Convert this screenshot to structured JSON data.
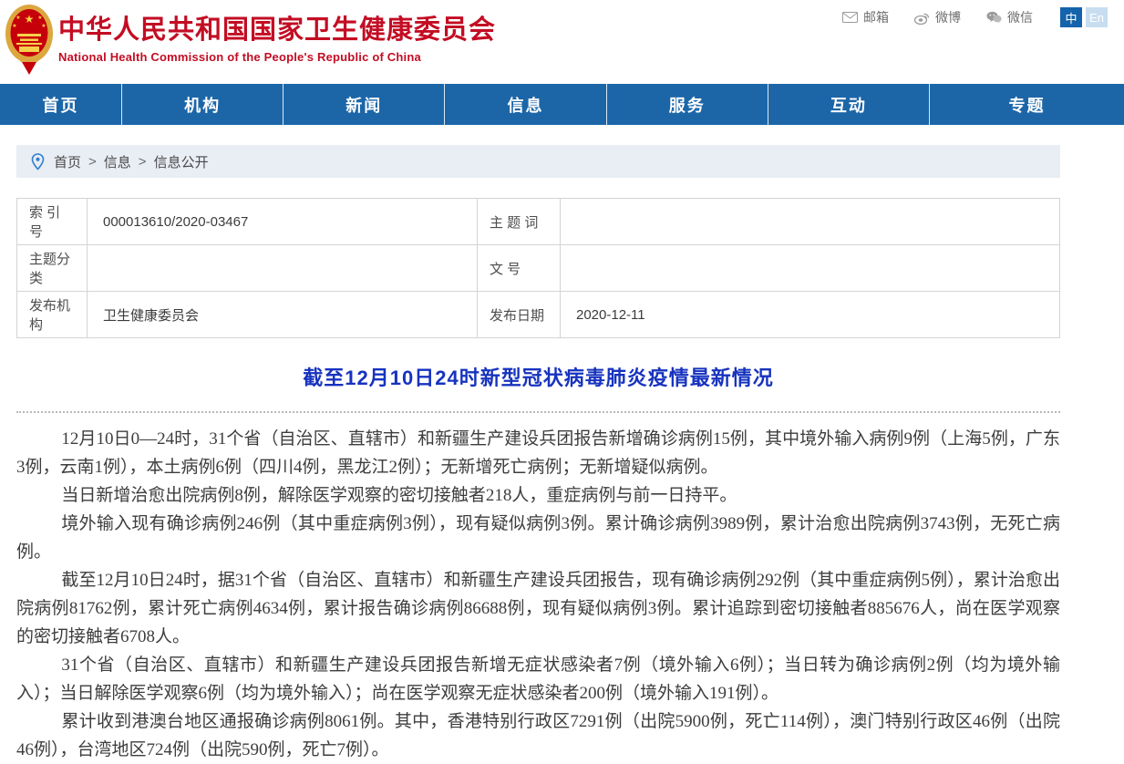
{
  "header": {
    "site_title": "中华人民共和国国家卫生健康委员会",
    "site_subtitle": "National Health Commission of the People's Republic of China",
    "social": [
      {
        "icon": "mail-icon",
        "label": "邮箱"
      },
      {
        "icon": "weibo-icon",
        "label": "微博"
      },
      {
        "icon": "wechat-icon",
        "label": "微信"
      }
    ],
    "lang": {
      "zh": "中",
      "en": "En"
    }
  },
  "nav": {
    "items": [
      {
        "label": "首页"
      },
      {
        "label": "机构"
      },
      {
        "label": "新闻"
      },
      {
        "label": "信息"
      },
      {
        "label": "服务"
      },
      {
        "label": "互动"
      },
      {
        "label": "专题"
      }
    ]
  },
  "breadcrumb": {
    "separator": ">",
    "items": [
      "首页",
      "信息",
      "信息公开"
    ]
  },
  "info_table": {
    "rows": [
      {
        "label1": "索 引 号",
        "value1": "000013610/2020-03467",
        "label2": "主 题 词",
        "value2": ""
      },
      {
        "label1": "主题分类",
        "value1": "",
        "label2": "文  号",
        "value2": ""
      },
      {
        "label1": "发布机构",
        "value1": "卫生健康委员会",
        "label2": "发布日期",
        "value2": "2020-12-11"
      }
    ]
  },
  "article": {
    "title": "截至12月10日24时新型冠状病毒肺炎疫情最新情况",
    "paragraphs": [
      "12月10日0—24时，31个省（自治区、直辖市）和新疆生产建设兵团报告新增确诊病例15例，其中境外输入病例9例（上海5例，广东3例，云南1例），本土病例6例（四川4例，黑龙江2例）；无新增死亡病例；无新增疑似病例。",
      "当日新增治愈出院病例8例，解除医学观察的密切接触者218人，重症病例与前一日持平。",
      "境外输入现有确诊病例246例（其中重症病例3例），现有疑似病例3例。累计确诊病例3989例，累计治愈出院病例3743例，无死亡病例。",
      "截至12月10日24时，据31个省（自治区、直辖市）和新疆生产建设兵团报告，现有确诊病例292例（其中重症病例5例），累计治愈出院病例81762例，累计死亡病例4634例，累计报告确诊病例86688例，现有疑似病例3例。累计追踪到密切接触者885676人，尚在医学观察的密切接触者6708人。",
      "31个省（自治区、直辖市）和新疆生产建设兵团报告新增无症状感染者7例（境外输入6例）；当日转为确诊病例2例（均为境外输入）；当日解除医学观察6例（均为境外输入）；尚在医学观察无症状感染者200例（境外输入191例）。",
      "累计收到港澳台地区通报确诊病例8061例。其中，香港特别行政区7291例（出院5900例，死亡114例），澳门特别行政区46例（出院46例），台湾地区724例（出院590例，死亡7例）。"
    ]
  },
  "colors": {
    "nav_blue": "#1c66a8",
    "brand_red": "#c30d23",
    "article_title_blue": "#1733bf",
    "breadcrumb_bg": "#e9edf4"
  }
}
